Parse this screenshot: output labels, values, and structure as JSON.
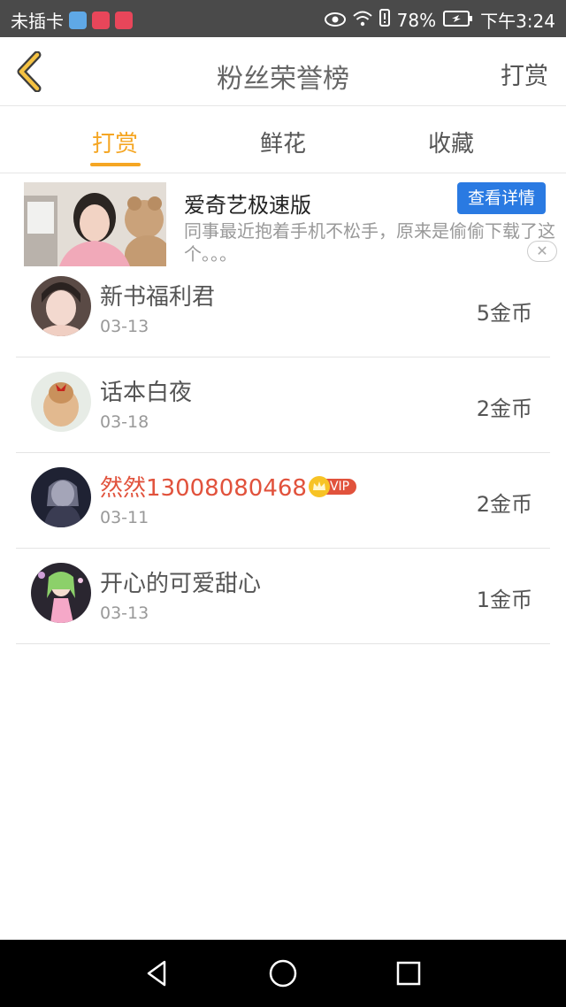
{
  "status_bar": {
    "carrier": "未插卡",
    "battery": "78%",
    "time": "下午3:24"
  },
  "header": {
    "title": "粉丝荣誉榜",
    "action_label": "打赏"
  },
  "tabs": [
    {
      "label": "打赏",
      "active": true
    },
    {
      "label": "鲜花",
      "active": false
    },
    {
      "label": "收藏",
      "active": false
    }
  ],
  "ad": {
    "title": "爱奇艺极速版",
    "button_label": "查看详情",
    "description": "同事最近抱着手机不松手，原来是偷偷下载了这个。。。"
  },
  "fans": [
    {
      "name": "新书福利君",
      "date": "03-13",
      "coins": "5金币"
    },
    {
      "name": "话本白夜",
      "date": "03-18",
      "coins": "2金币"
    },
    {
      "name": "然然13008080468",
      "date": "03-11",
      "coins": "2金币",
      "vip_label": "VIP"
    },
    {
      "name": "开心的可爱甜心",
      "date": "03-13",
      "coins": "1金币"
    }
  ],
  "colors": {
    "accent": "#f5a623",
    "vip_name": "#e1523c",
    "ad_button": "#2a7ae2"
  }
}
